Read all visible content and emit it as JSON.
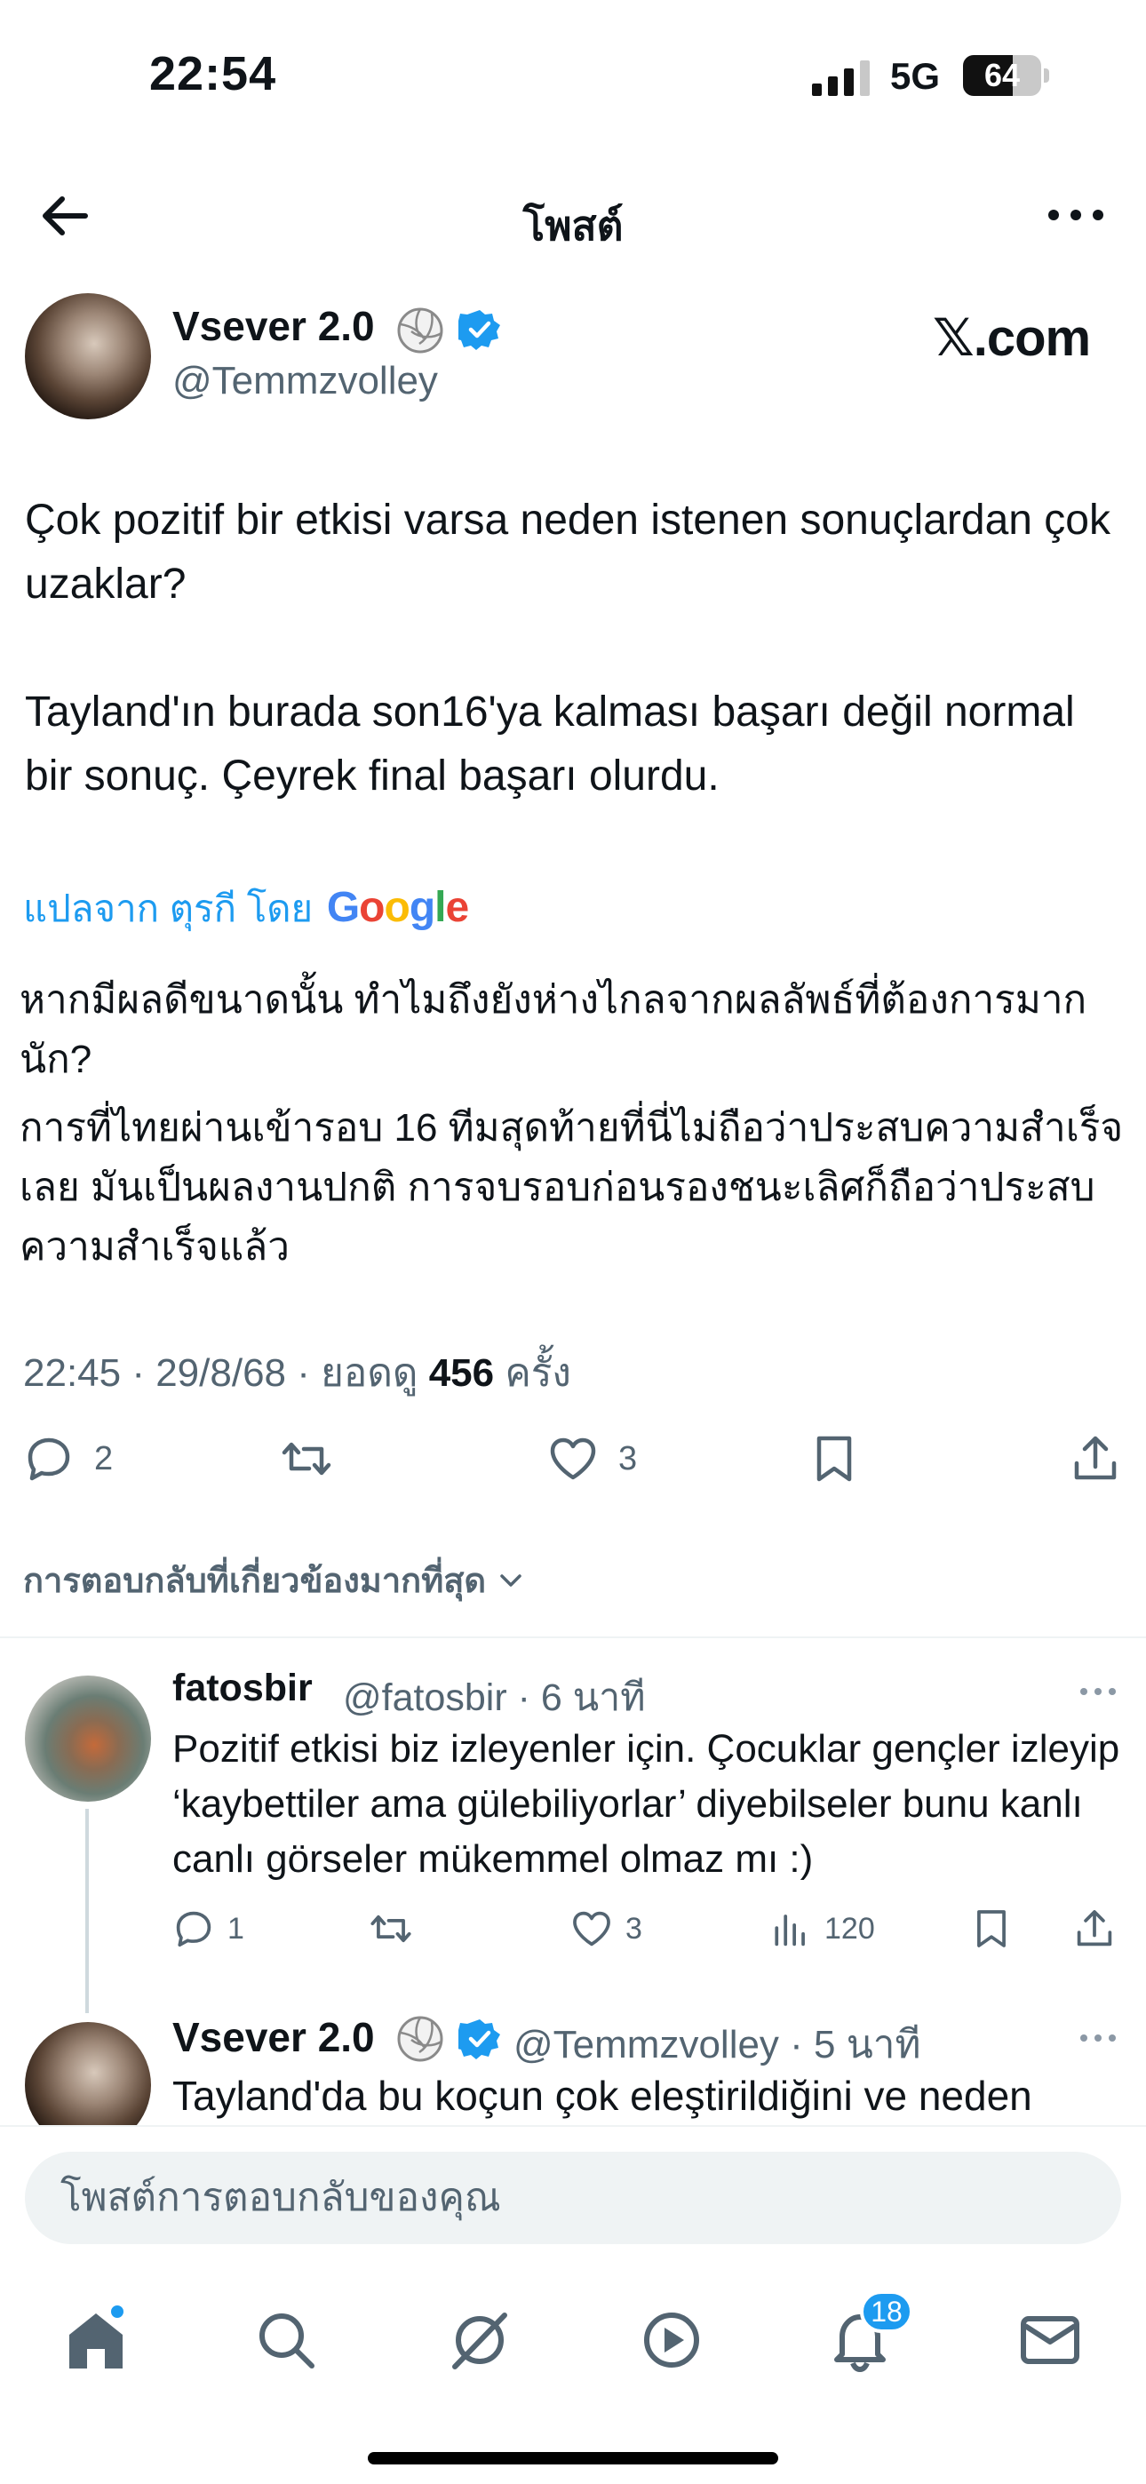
{
  "status_bar": {
    "time": "22:54",
    "network": "5G",
    "battery": "64",
    "battery_level": 0.64
  },
  "header": {
    "title": "โพสต์"
  },
  "post": {
    "author_name": "Vsever 2.0",
    "author_handle": "@Temmzvolley",
    "source": "𝕏.com",
    "text_paragraphs": [
      "Çok pozitif bir etkisi varsa neden istenen sonuçlardan çok uzaklar?",
      "Tayland'ın burada son16'ya kalması başarı değil normal bir sonuç. Çeyrek final başarı olurdu."
    ],
    "translated_label": "แปลจาก ตุรกี โดย",
    "translator": "Google",
    "translation_paragraphs": [
      "หากมีผลดีขนาดนั้น ทำไมถึงยังห่างไกลจากผลลัพธ์ที่ต้องการมากนัก?",
      "การที่ไทยผ่านเข้ารอบ 16 ทีมสุดท้ายที่นี่ไม่ถือว่าประสบความสำเร็จเลย มันเป็นผลงานปกติ การจบรอบก่อนรองชนะเลิศก็ถือว่าประสบความสำเร็จแล้ว"
    ],
    "timestamp": "22:45 · 29/8/68 · ยอดดู ",
    "views": "456",
    "views_suffix": " ครั้ง",
    "replies_count": "2",
    "likes_count": "3"
  },
  "sort_label": "การตอบกลับที่เกี่ยวข้องมากที่สุด",
  "replies": [
    {
      "name": "fatosbir",
      "handle_time": "@fatosbir · 6 นาที",
      "text": "Pozitif etkisi biz izleyenler için. Çocuklar gençler izleyip ‘kaybettiler ama gülebiliyorlar’ diyebilseler bunu kanlı canlı görseler mükemmel olmaz mı :)",
      "replies": "1",
      "likes": "3",
      "views": "120"
    },
    {
      "name": "Vsever 2.0",
      "handle_time": "@Temmzvolley · 5 นาที",
      "text": "Tayland'da bu koçun çok eleştirildiğini ve neden"
    }
  ],
  "composer": {
    "placeholder": "โพสต์การตอบกลับของคุณ"
  },
  "tabbar": {
    "notifications_badge": "18"
  },
  "colors": {
    "accent": "#1d9bf0",
    "text": "#0f1419",
    "muted": "#536471",
    "like": "#536471"
  },
  "icons": [
    "back-arrow-icon",
    "more-icon",
    "volleyball-icon",
    "verified-icon",
    "reply-icon",
    "repost-icon",
    "like-icon",
    "bookmark-icon",
    "share-icon",
    "views-icon",
    "home-icon",
    "search-icon",
    "grok-icon",
    "play-icon",
    "bell-icon",
    "mail-icon"
  ]
}
